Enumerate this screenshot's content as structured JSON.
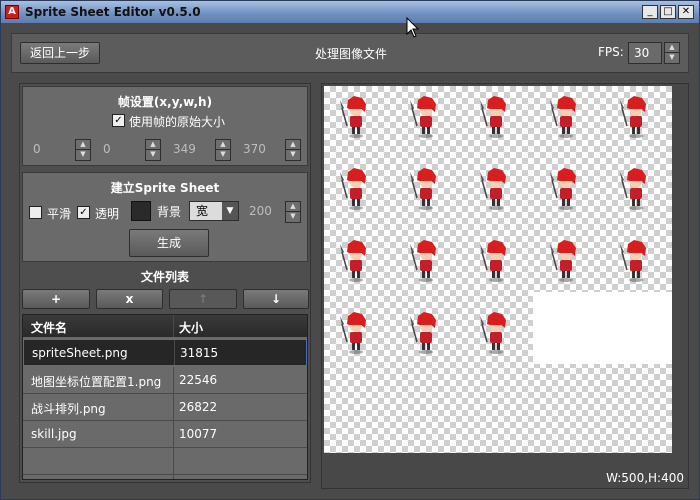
{
  "window": {
    "title": "Sprite Sheet Editor v0.5.0",
    "minimize_glyph": "_",
    "maximize_glyph": "□",
    "close_glyph": "✕"
  },
  "topbar": {
    "back_label": "返回上一步",
    "title": "处理图像文件",
    "fps_label": "FPS:",
    "fps_value": "30"
  },
  "frame_settings": {
    "title": "帧设置(x,y,w,h)",
    "use_original_size_label": "使用帧的原始大小",
    "use_original_size_checked": true,
    "x": "0",
    "y": "0",
    "w": "349",
    "h": "370"
  },
  "build": {
    "title": "建立Sprite Sheet",
    "smooth_label": "平滑",
    "smooth_checked": false,
    "transparent_label": "透明",
    "transparent_checked": true,
    "background_label": "背景",
    "background_color": "#2a2a2a",
    "width_mode": "宽",
    "width_value": "200",
    "generate_label": "生成"
  },
  "files": {
    "title": "文件列表",
    "add_label": "+",
    "remove_label": "x",
    "move_up_label": "↑",
    "move_down_label": "↓",
    "columns": [
      "文件名",
      "大小"
    ],
    "rows": [
      {
        "name": "spriteSheet.png",
        "size": "31815",
        "selected": true
      },
      {
        "name": "地图坐标位置配置1.png",
        "size": "22546",
        "selected": false
      },
      {
        "name": "战斗排列.png",
        "size": "26822",
        "selected": false
      },
      {
        "name": "skill.jpg",
        "size": "10077",
        "selected": false
      },
      {
        "name": "",
        "size": "",
        "selected": false
      },
      {
        "name": "",
        "size": "",
        "selected": false
      }
    ]
  },
  "preview": {
    "dimensions": "W:500,H:400",
    "sprite_rows": [
      5,
      5,
      5,
      3
    ]
  },
  "colors": {
    "accent": "#4a6fb3",
    "sprite_hair": "#d81e1e",
    "titlebar": "#6f8fbf"
  }
}
